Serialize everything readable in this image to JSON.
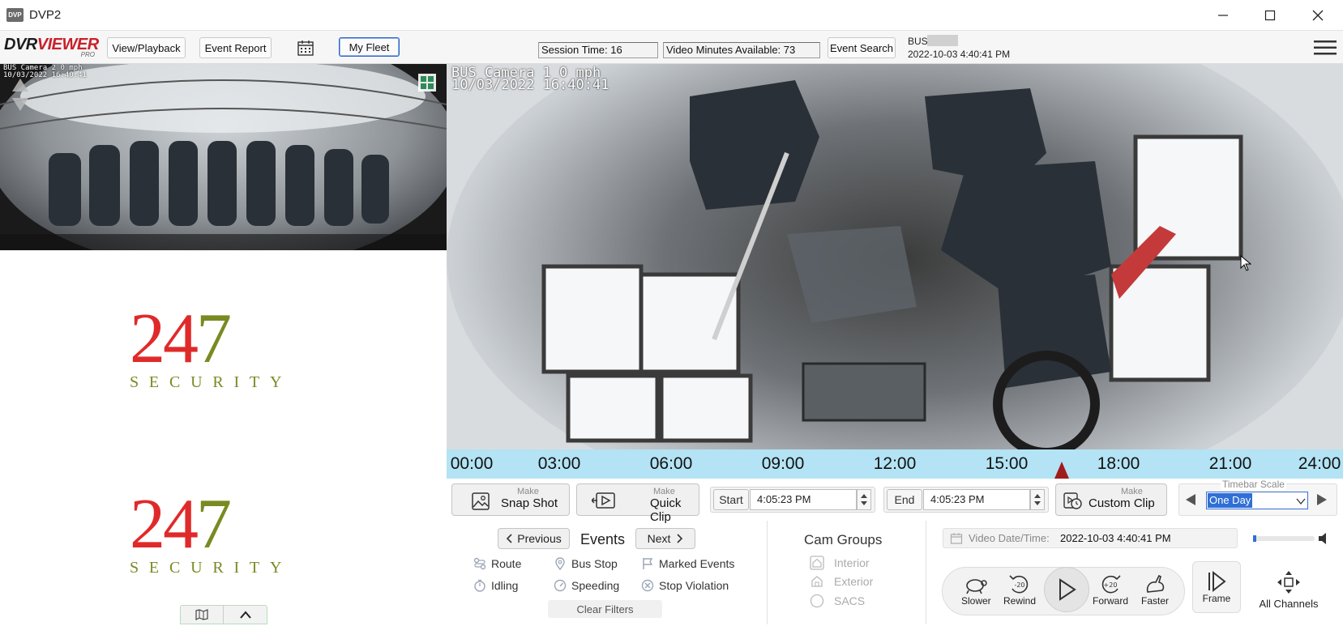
{
  "window": {
    "logo_text": "DVP",
    "title": "DVP2"
  },
  "toolbar": {
    "brand_main_a": "DVR",
    "brand_main_b": "VIEWER",
    "brand_sub": "PRO",
    "view_playback": "View/Playback",
    "event_report": "Event Report",
    "my_fleet": "My Fleet",
    "session_time": "Session Time: 16",
    "video_minutes": "Video Minutes Available: 73",
    "event_search": "Event Search",
    "bus_label": "BUS",
    "bus_datetime": "2022-10-03 4:40:41 PM"
  },
  "left_panel": {
    "cam_osd_line1": "BUS      Camera 2    0 mph",
    "cam_osd_line2": "10/03/2022 16:40:41",
    "logo_digits": [
      "2",
      "4",
      "7"
    ],
    "logo_word": "SECURITY"
  },
  "main_camera": {
    "osd_line1": "BUS       Camera 1     0 mph",
    "osd_line2": "10/03/2022 16:40:41"
  },
  "timeline": {
    "ticks": [
      "00:00",
      "03:00",
      "06:00",
      "09:00",
      "12:00",
      "15:00",
      "18:00",
      "21:00",
      "24:00"
    ],
    "playhead_hour": 16.7
  },
  "clip": {
    "make": "Make",
    "snap_shot": "Snap Shot",
    "quick_clip": "Quick Clip",
    "custom_clip": "Custom Clip",
    "start_label": "Start",
    "start_value": "4:05:23 PM",
    "end_label": "End",
    "end_value": "4:05:23 PM",
    "timebar_scale_label": "Timebar Scale",
    "timebar_scale_value": "One Day"
  },
  "events": {
    "previous": "Previous",
    "title": "Events",
    "next": "Next",
    "items": [
      "Route",
      "Bus Stop",
      "Marked Events",
      "Idling",
      "Speeding",
      "Stop Violation"
    ],
    "clear_filters": "Clear Filters"
  },
  "cam_groups": {
    "title": "Cam Groups",
    "items": [
      "Interior",
      "Exterior",
      "SACS"
    ]
  },
  "playback": {
    "video_datetime_label": "Video Date/Time:",
    "video_datetime_value": "2022-10-03 4:40:41 PM",
    "volume_level": 0.05,
    "slower": "Slower",
    "rewind": "Rewind",
    "rewind_badge": "-20",
    "forward": "Forward",
    "forward_badge": "+20",
    "faster": "Faster",
    "frame": "Frame",
    "all_channels": "All Channels"
  },
  "colors": {
    "timeline_bg": "#b3e3f4",
    "playhead": "#a01c1c",
    "logo_red": "#e02a2a",
    "logo_green": "#7a8a22",
    "brand_red": "#c8202a"
  }
}
